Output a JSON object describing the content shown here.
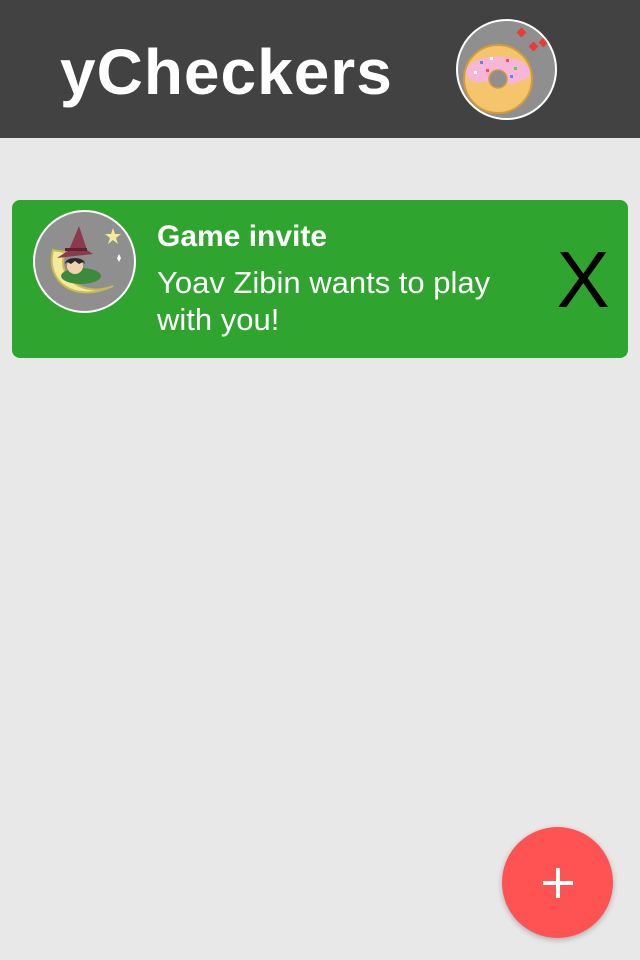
{
  "header": {
    "title": "yCheckers",
    "avatar_icon": "donut-avatar-icon"
  },
  "invite": {
    "title": "Game invite",
    "message": "Yoav Zibin wants to play with you!",
    "avatar_icon": "witch-on-moon-avatar-icon",
    "dismiss_label": "X"
  },
  "fab": {
    "icon": "plus-icon"
  },
  "colors": {
    "header_bg": "#424242",
    "page_bg": "#e8e8e8",
    "card_bg": "#2fa52f",
    "fab_bg": "#ff5252"
  }
}
